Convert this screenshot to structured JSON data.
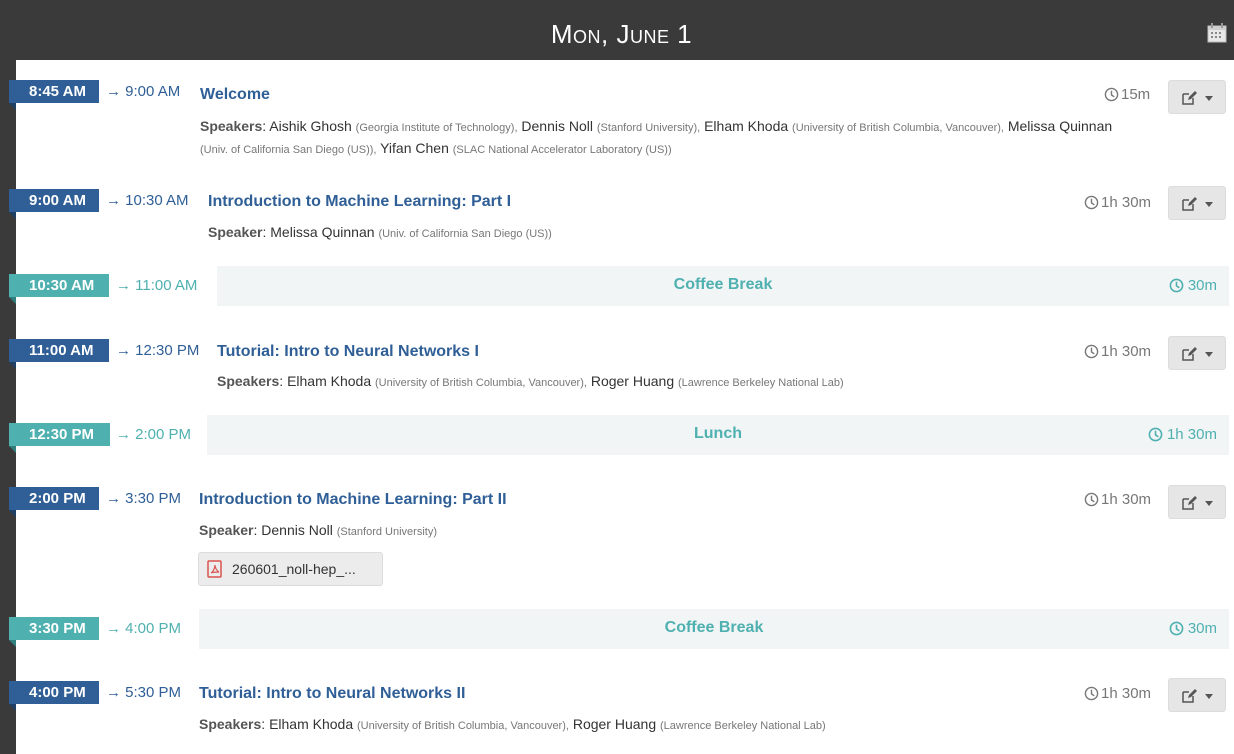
{
  "header": {
    "title": "Mon, June 1"
  },
  "colors": {
    "contribution": "#2f5f96",
    "break": "#4fb0b0",
    "frame": "#3a3a3a"
  },
  "rows": [
    {
      "start": "8:45 AM",
      "end": "→ 9:00 AM",
      "title": "Welcome",
      "duration": "15m",
      "speakers_label": "Speakers",
      "speakers": [
        {
          "name": "Aishik Ghosh",
          "aff": "(Georgia Institute of Technology),"
        },
        {
          "name": "Dennis Noll",
          "aff": "(Stanford University),"
        },
        {
          "name": "Elham Khoda",
          "aff": "(University of British Columbia, Vancouver),"
        },
        {
          "name": "Melissa Quinnan",
          "aff": "(Univ. of California San Diego (US)),"
        },
        {
          "name": "Yifan Chen",
          "aff": "(SLAC National Accelerator Laboratory (US))"
        }
      ]
    },
    {
      "start": "9:00 AM",
      "end": "→ 10:30 AM",
      "title": "Introduction to Machine Learning: Part I",
      "duration": "1h 30m",
      "speakers_label": "Speaker",
      "speakers": [
        {
          "name": "Melissa Quinnan",
          "aff": "(Univ. of California San Diego (US))"
        }
      ]
    },
    {
      "start": "10:30 AM",
      "end": "→ 11:00 AM",
      "title": "Coffee Break",
      "duration": "30m"
    },
    {
      "start": "11:00 AM",
      "end": "→ 12:30 PM",
      "title": "Tutorial: Intro to Neural Networks I",
      "duration": "1h 30m",
      "speakers_label": "Speakers",
      "speakers": [
        {
          "name": "Elham Khoda",
          "aff": "(University of British Columbia, Vancouver),"
        },
        {
          "name": "Roger Huang",
          "aff": "(Lawrence Berkeley National Lab)"
        }
      ]
    },
    {
      "start": "12:30 PM",
      "end": "→ 2:00 PM",
      "title": "Lunch",
      "duration": "1h 30m"
    },
    {
      "start": "2:00 PM",
      "end": "→ 3:30 PM",
      "title": "Introduction to Machine Learning: Part II",
      "duration": "1h 30m",
      "speakers_label": "Speaker",
      "speakers": [
        {
          "name": "Dennis Noll",
          "aff": "(Stanford University)"
        }
      ],
      "attachment": "260601_noll-hep_..."
    },
    {
      "start": "3:30 PM",
      "end": "→ 4:00 PM",
      "title": "Coffee Break",
      "duration": "30m"
    },
    {
      "start": "4:00 PM",
      "end": "→ 5:30 PM",
      "title": "Tutorial: Intro to Neural Networks II",
      "duration": "1h 30m",
      "speakers_label": "Speakers",
      "speakers": [
        {
          "name": "Elham Khoda",
          "aff": "(University of British Columbia, Vancouver),"
        },
        {
          "name": "Roger Huang",
          "aff": "(Lawrence Berkeley National Lab)"
        }
      ]
    }
  ]
}
